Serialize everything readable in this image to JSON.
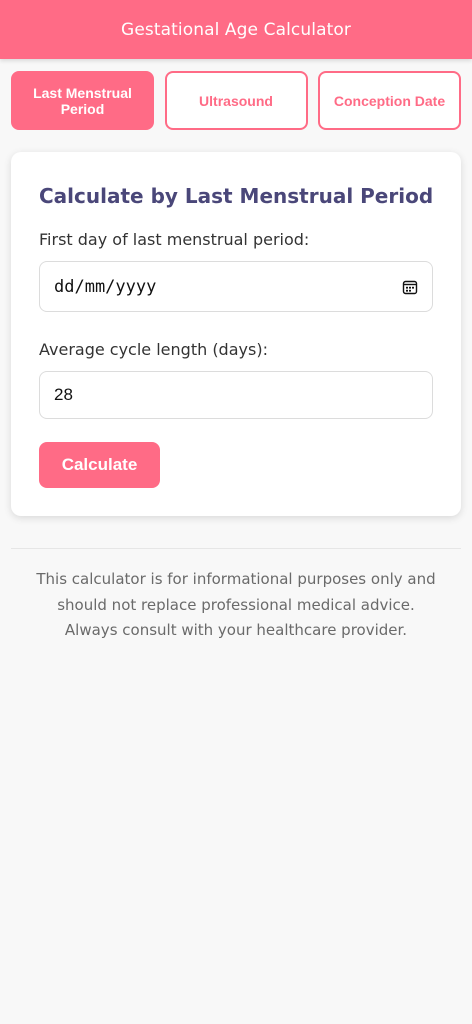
{
  "header": {
    "title": "Gestational Age Calculator"
  },
  "tabs": [
    {
      "label": "Last Menstrual Period",
      "active": true
    },
    {
      "label": "Ultrasound",
      "active": false
    },
    {
      "label": "Conception Date",
      "active": false
    }
  ],
  "form": {
    "title": "Calculate by Last Menstrual Period",
    "lmp_label": "First day of last menstrual period:",
    "lmp_placeholder": "dd/mm/yyyy",
    "lmp_icon": "calendar-icon",
    "cycle_label": "Average cycle length (days):",
    "cycle_value": "28",
    "calculate_label": "Calculate"
  },
  "footer": {
    "disclaimer": "This calculator is for informational purposes only and should not replace professional medical advice. Always consult with your healthcare provider."
  },
  "colors": {
    "accent": "#ff6b86",
    "heading": "#4a4779",
    "background": "#f8f8f8"
  }
}
